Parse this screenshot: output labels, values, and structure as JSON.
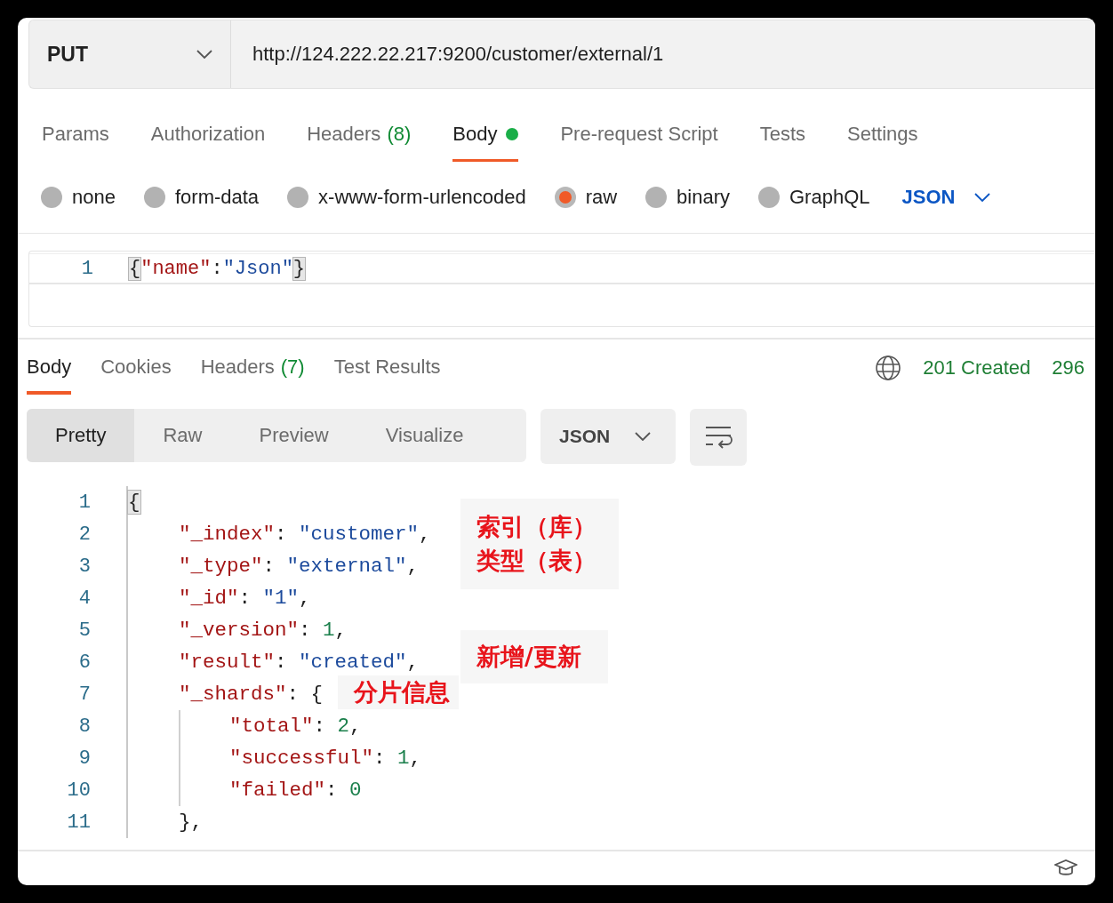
{
  "request": {
    "method": "PUT",
    "url": "http://124.222.22.217:9200/customer/external/1"
  },
  "request_tabs": [
    {
      "label": "Params",
      "selected": false
    },
    {
      "label": "Authorization",
      "selected": false
    },
    {
      "label": "Headers",
      "count": "(8)",
      "selected": false
    },
    {
      "label": "Body",
      "modified": true,
      "selected": true
    },
    {
      "label": "Pre-request Script",
      "selected": false
    },
    {
      "label": "Tests",
      "selected": false
    },
    {
      "label": "Settings",
      "selected": false
    }
  ],
  "body_types": [
    {
      "label": "none",
      "selected": false
    },
    {
      "label": "form-data",
      "selected": false
    },
    {
      "label": "x-www-form-urlencoded",
      "selected": false
    },
    {
      "label": "raw",
      "selected": true
    },
    {
      "label": "binary",
      "selected": false
    },
    {
      "label": "GraphQL",
      "selected": false
    }
  ],
  "body_language": "JSON",
  "request_body": [
    {
      "number": "1",
      "tokens": [
        {
          "kind": "match",
          "text": "{"
        },
        {
          "kind": "key",
          "text": "\"name\""
        },
        {
          "kind": "punct",
          "text": ":"
        },
        {
          "kind": "string",
          "text": "\"Json\""
        },
        {
          "kind": "match",
          "text": "}"
        }
      ]
    }
  ],
  "response_tabs": [
    {
      "label": "Body",
      "selected": true
    },
    {
      "label": "Cookies",
      "selected": false
    },
    {
      "label": "Headers",
      "count": "(7)",
      "selected": false
    },
    {
      "label": "Test Results",
      "selected": false
    }
  ],
  "response_status": {
    "status": "201 Created",
    "time": "296"
  },
  "view_modes": [
    {
      "label": "Pretty",
      "selected": true
    },
    {
      "label": "Raw",
      "selected": false
    },
    {
      "label": "Preview",
      "selected": false
    },
    {
      "label": "Visualize",
      "selected": false
    }
  ],
  "response_format": "JSON",
  "response_body": [
    {
      "number": "1",
      "tokens": [
        {
          "kind": "match",
          "text": "{"
        }
      ],
      "children": [
        {
          "number": "2",
          "tokens": [
            {
              "kind": "key",
              "text": "\"_index\""
            },
            {
              "kind": "punct",
              "text": ": "
            },
            {
              "kind": "string",
              "text": "\"customer\""
            },
            {
              "kind": "punct",
              "text": ","
            }
          ]
        },
        {
          "number": "3",
          "tokens": [
            {
              "kind": "key",
              "text": "\"_type\""
            },
            {
              "kind": "punct",
              "text": ": "
            },
            {
              "kind": "string",
              "text": "\"external\""
            },
            {
              "kind": "punct",
              "text": ","
            }
          ]
        },
        {
          "number": "4",
          "tokens": [
            {
              "kind": "key",
              "text": "\"_id\""
            },
            {
              "kind": "punct",
              "text": ": "
            },
            {
              "kind": "string",
              "text": "\"1\""
            },
            {
              "kind": "punct",
              "text": ","
            }
          ]
        },
        {
          "number": "5",
          "tokens": [
            {
              "kind": "key",
              "text": "\"_version\""
            },
            {
              "kind": "punct",
              "text": ": "
            },
            {
              "kind": "number",
              "text": "1"
            },
            {
              "kind": "punct",
              "text": ","
            }
          ]
        },
        {
          "number": "6",
          "tokens": [
            {
              "kind": "key",
              "text": "\"result\""
            },
            {
              "kind": "punct",
              "text": ": "
            },
            {
              "kind": "string",
              "text": "\"created\""
            },
            {
              "kind": "punct",
              "text": ","
            }
          ]
        },
        {
          "number": "7",
          "tokens": [
            {
              "kind": "key",
              "text": "\"_shards\""
            },
            {
              "kind": "punct",
              "text": ": {"
            }
          ],
          "children": [
            {
              "number": "8",
              "tokens": [
                {
                  "kind": "key",
                  "text": "\"total\""
                },
                {
                  "kind": "punct",
                  "text": ": "
                },
                {
                  "kind": "number",
                  "text": "2"
                },
                {
                  "kind": "punct",
                  "text": ","
                }
              ]
            },
            {
              "number": "9",
              "tokens": [
                {
                  "kind": "key",
                  "text": "\"successful\""
                },
                {
                  "kind": "punct",
                  "text": ": "
                },
                {
                  "kind": "number",
                  "text": "1"
                },
                {
                  "kind": "punct",
                  "text": ","
                }
              ]
            },
            {
              "number": "10",
              "tokens": [
                {
                  "kind": "key",
                  "text": "\"failed\""
                },
                {
                  "kind": "punct",
                  "text": ": "
                },
                {
                  "kind": "number",
                  "text": "0"
                }
              ]
            }
          ]
        },
        {
          "number": "11",
          "tokens": [
            {
              "kind": "punct",
              "text": "},"
            }
          ]
        }
      ]
    }
  ],
  "annotations": [
    {
      "lines": [
        "索引（库）",
        "类型（表）"
      ]
    },
    {
      "lines": [
        "新增/更新"
      ]
    },
    {
      "lines": [
        "分片信息"
      ]
    }
  ]
}
